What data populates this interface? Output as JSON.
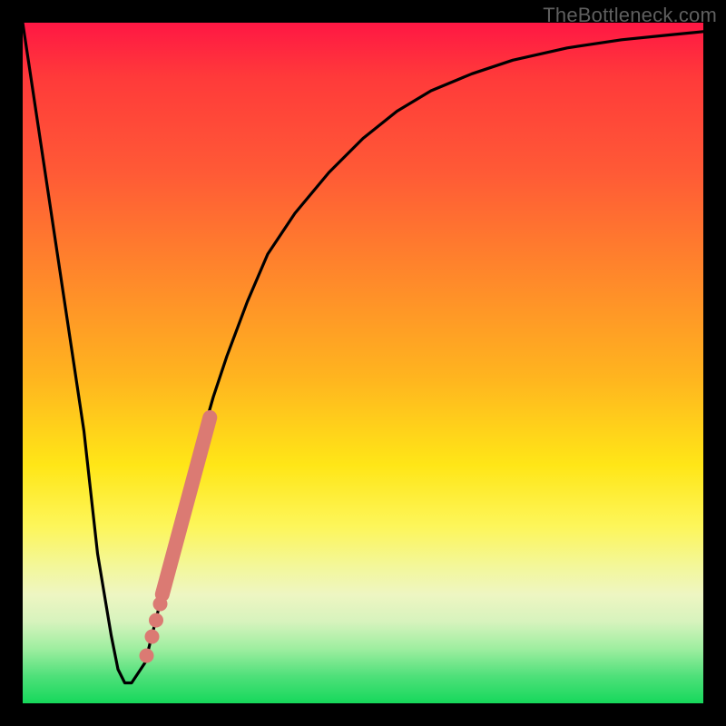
{
  "watermark": "TheBottleneck.com",
  "colors": {
    "curve": "#000000",
    "highlight": "#db7a73",
    "background_frame": "#000000"
  },
  "chart_data": {
    "type": "line",
    "title": "",
    "xlabel": "",
    "ylabel": "",
    "xlim": [
      0,
      100
    ],
    "ylim": [
      0,
      100
    ],
    "series": [
      {
        "name": "bottleneck-curve",
        "x": [
          0,
          3,
          6,
          9,
          11,
          13,
          14,
          15,
          16,
          18,
          20,
          22,
          24,
          26,
          28,
          30,
          33,
          36,
          40,
          45,
          50,
          55,
          60,
          66,
          72,
          80,
          88,
          95,
          100
        ],
        "y": [
          100,
          80,
          60,
          40,
          22,
          10,
          5,
          3,
          3,
          6,
          14,
          22,
          30,
          38,
          45,
          51,
          59,
          66,
          72,
          78,
          83,
          87,
          90,
          92.5,
          94.5,
          96.3,
          97.5,
          98.2,
          98.7
        ]
      }
    ],
    "highlight_segment": {
      "name": "thick-salmon-band",
      "x": [
        20.5,
        27.5
      ],
      "y": [
        16,
        42
      ]
    },
    "highlight_dots": [
      {
        "x": 18.2,
        "y": 7.0
      },
      {
        "x": 19.0,
        "y": 9.8
      },
      {
        "x": 19.6,
        "y": 12.2
      },
      {
        "x": 20.2,
        "y": 14.6
      }
    ]
  }
}
